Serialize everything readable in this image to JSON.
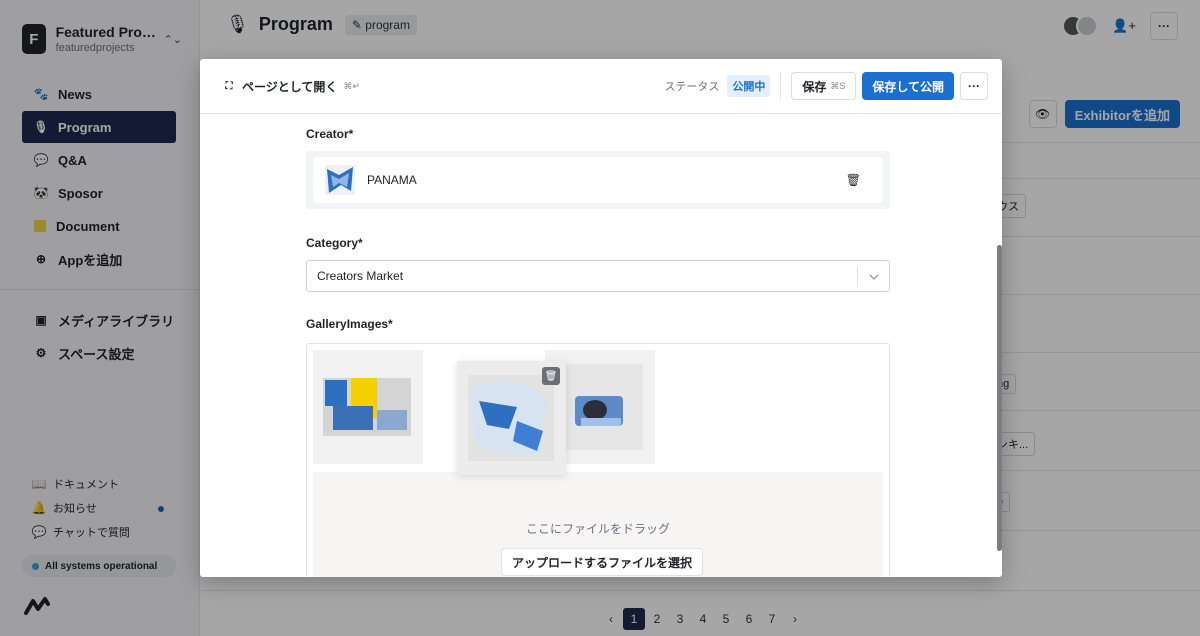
{
  "sidebar": {
    "workspace": {
      "initial": "F",
      "name": "Featured Proje...",
      "id": "featuredprojects"
    },
    "nav": [
      {
        "label": "News",
        "icon": "paw-icon"
      },
      {
        "label": "Program",
        "icon": "microphone-icon"
      },
      {
        "label": "Q&A",
        "icon": "chat-bubble-icon"
      },
      {
        "label": "Sposor",
        "icon": "panda-icon"
      },
      {
        "label": "Document",
        "icon": "document-icon"
      },
      {
        "label": "Appを追加",
        "icon": "plus-circle-icon"
      }
    ],
    "tools": [
      {
        "label": "メディアライブラリ",
        "icon": "image-icon"
      },
      {
        "label": "スペース設定",
        "icon": "gear-icon"
      }
    ],
    "footer": [
      {
        "label": "ドキュメント",
        "icon": "book-icon"
      },
      {
        "label": "お知らせ",
        "icon": "bell-icon"
      },
      {
        "label": "チャットで質問",
        "icon": "chat-icon"
      }
    ],
    "status": "All systems operational"
  },
  "main": {
    "title": "Program",
    "api_id": "program",
    "add_button": "Exhibitorを追加",
    "chips": [
      "ウス",
      "ng",
      "ンキ...",
      "e"
    ],
    "pagination": [
      "1",
      "2",
      "3",
      "4",
      "5",
      "6",
      "7"
    ],
    "current_page": "1"
  },
  "modal": {
    "open_as_page": "ページとして開く",
    "open_shortcut": "⌘↵",
    "status_label": "ステータス",
    "status_value": "公開中",
    "save": "保存",
    "save_shortcut": "⌘S",
    "save_publish": "保存して公開",
    "fields": {
      "creator_label": "Creator*",
      "creator_value": "PANAMA",
      "category_label": "Category*",
      "category_value": "Creators Market",
      "gallery_label": "GalleryImages*",
      "dropzone_text": "ここにファイルをドラッグ",
      "upload_button": "アップロードするファイルを選択"
    }
  },
  "colors": {
    "accent": "#1a6fd1",
    "nav_active": "#1d2a4f"
  }
}
